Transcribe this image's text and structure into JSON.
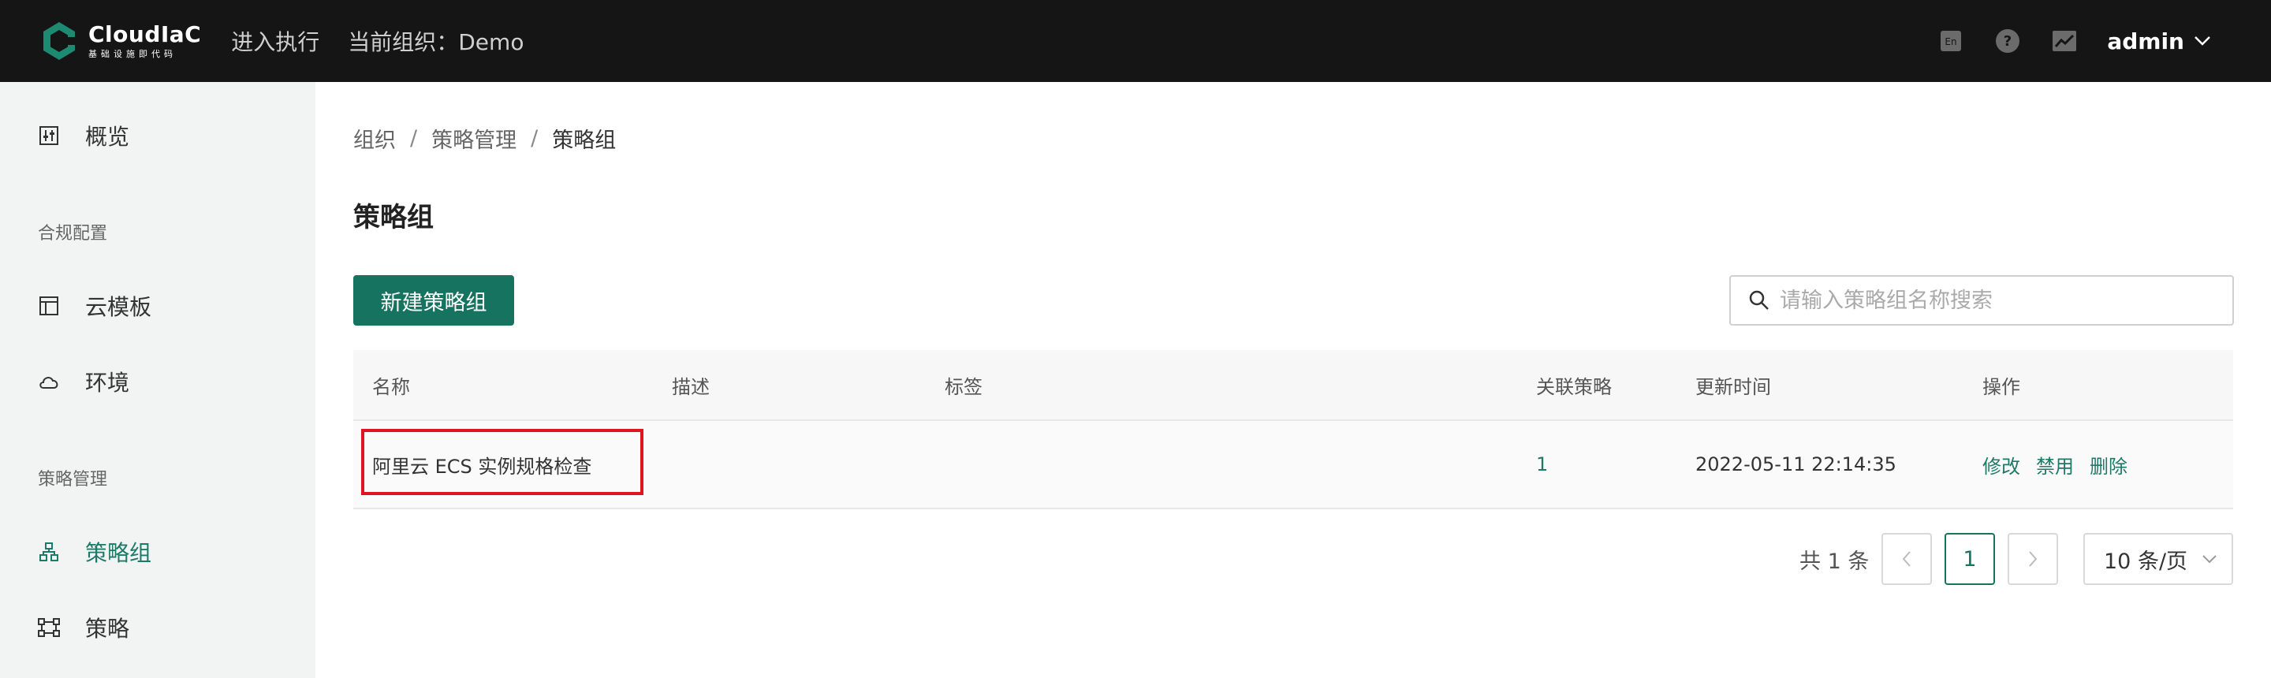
{
  "header": {
    "logo_name": "CloudIaC",
    "logo_sub": "基础设施即代码",
    "enter_exec": "进入执行",
    "org_label": "当前组织：Demo",
    "lang_icon_text": "En",
    "user": "admin"
  },
  "sidebar": {
    "overview": "概览",
    "group_compliance": "合规配置",
    "cloud_template": "云模板",
    "environment": "环境",
    "group_policy": "策略管理",
    "policy_group": "策略组",
    "policy": "策略"
  },
  "main": {
    "breadcrumb": [
      "组织",
      "策略管理",
      "策略组"
    ],
    "title": "策略组",
    "new_button": "新建策略组",
    "search_placeholder": "请输入策略组名称搜索",
    "table": {
      "columns": [
        "名称",
        "描述",
        "标签",
        "关联策略",
        "更新时间",
        "操作"
      ],
      "rows": [
        {
          "name": "阿里云 ECS 实例规格检查",
          "description": "",
          "tags": "",
          "related_policies": "1",
          "updated_at": "2022-05-11 22:14:35",
          "actions": [
            "修改",
            "禁用",
            "删除"
          ]
        }
      ]
    },
    "pagination": {
      "total_text": "共 1 条",
      "current_page": "1",
      "page_size": "10 条/页"
    }
  },
  "colors": {
    "accent": "#16735f",
    "header_bg": "#151515",
    "sidebar_bg": "#f2f4f4",
    "highlight": "#e0141e"
  }
}
